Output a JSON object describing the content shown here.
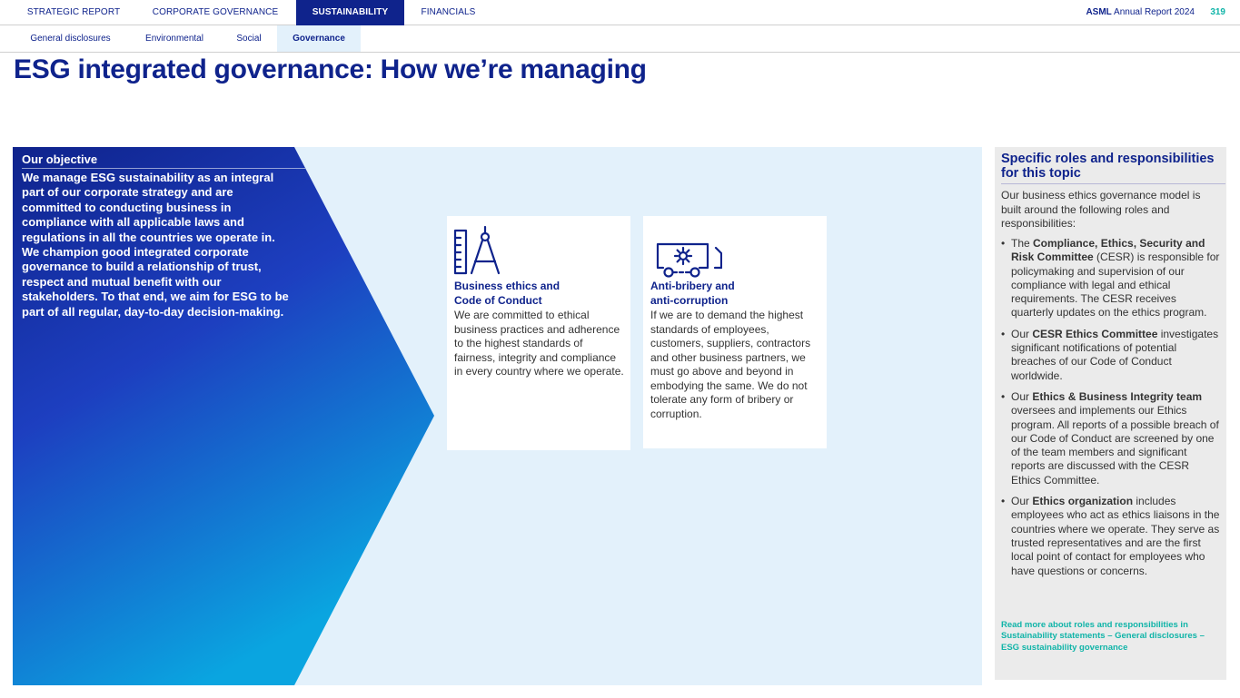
{
  "top_nav": {
    "tabs": [
      {
        "label": "STRATEGIC REPORT"
      },
      {
        "label": "CORPORATE GOVERNANCE"
      },
      {
        "label": "SUSTAINABILITY"
      },
      {
        "label": "FINANCIALS"
      }
    ],
    "active_tab": "SUSTAINABILITY",
    "brand": "ASML",
    "report_title": "Annual Report 2024",
    "page_number": "319"
  },
  "sub_nav": {
    "tabs": [
      {
        "label": "General disclosures"
      },
      {
        "label": "Environmental"
      },
      {
        "label": "Social"
      },
      {
        "label": "Governance"
      }
    ],
    "active_tab": "Governance"
  },
  "page_title": "ESG integrated governance: How we’re managing",
  "objective": {
    "label": "Our objective",
    "text": "We manage ESG sustainability as an integral part of our corporate strategy and are committed to conducting business in compliance with all applicable laws and regulations in all the countries we operate in. We champion good integrated corporate governance to build a relationship of trust, respect and mutual benefit with our stakeholders. To that end, we aim for ESG to be part of all regular, day-to-day decision-making."
  },
  "cards": [
    {
      "icon": "ruler-compass-icon",
      "title_line1": "Business ethics and",
      "title_line2": "Code of Conduct",
      "text": "We are committed to ethical business practices and adherence to the highest standards of fairness, integrity and compliance in every country where we operate."
    },
    {
      "icon": "gear-conveyor-icon",
      "title_line1": "Anti-bribery and",
      "title_line2": "anti-corruption",
      "text": "If we are to demand the highest standards of employees, customers, suppliers, contractors and other business partners, we must go above and beyond in embodying the same. We do not tolerate any form of bribery or corruption."
    }
  ],
  "roles": {
    "title": "Specific roles and responsibilities for this topic",
    "intro": "Our business ethics governance model is built around the following roles and responsibilities:",
    "items": [
      {
        "prefix": "The ",
        "bold": "Compliance, Ethics, Security and Risk Committee",
        "text": " (CESR) is responsible for policymaking and supervision of our compliance with legal and ethical requirements. The CESR receives quarterly updates on the ethics program."
      },
      {
        "prefix": "Our ",
        "bold": "CESR Ethics Committee",
        "text": " investigates significant notifications of potential breaches of our Code of Conduct worldwide."
      },
      {
        "prefix": "Our ",
        "bold": "Ethics & Business Integrity team",
        "text": " oversees and implements our Ethics program. All reports of a possible breach of our Code of Conduct are screened by one of the team members and significant reports are discussed with the CESR Ethics Committee."
      },
      {
        "prefix": "Our ",
        "bold": "Ethics organization",
        "text": " includes employees who act as ethics liaisons in the countries where we operate. They serve as trusted representatives and are the first local point of contact for employees who have questions or concerns."
      }
    ],
    "read_more": "Read more about roles and responsibilities in Sustainability statements – General disclosures – ESG sustainability governance"
  },
  "colors": {
    "primary": "#0f238c",
    "accent": "#10b4a8",
    "panel_light": "#e3f1fb",
    "panel_grey": "#ebebeb",
    "arrow_gradient_top": "#0f238c",
    "arrow_gradient_bottom": "#0aa5e0"
  }
}
